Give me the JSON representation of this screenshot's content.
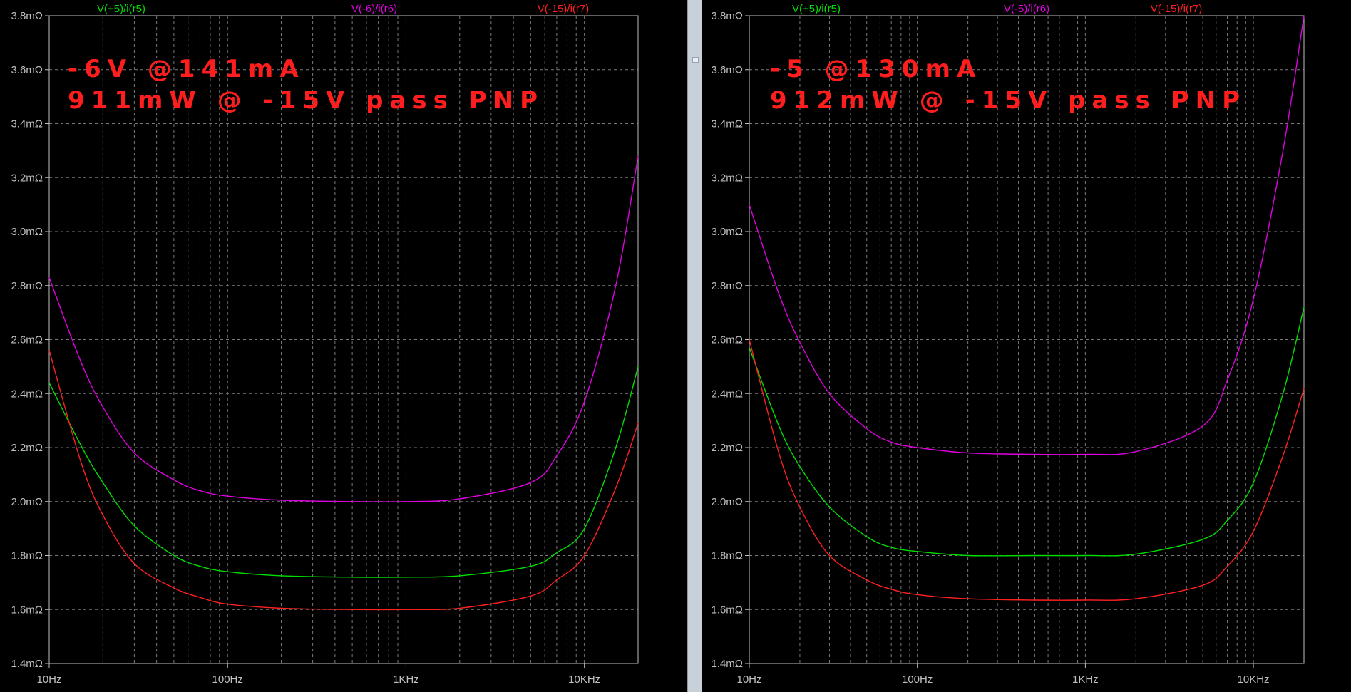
{
  "chart_data": [
    {
      "type": "line",
      "x_scale": "log",
      "xlim": [
        10,
        20000
      ],
      "ylim": [
        1.4,
        3.8
      ],
      "grid": true,
      "yticks": [
        "1.4mΩ",
        "1.6mΩ",
        "1.8mΩ",
        "2.0mΩ",
        "2.2mΩ",
        "2.4mΩ",
        "2.6mΩ",
        "2.8mΩ",
        "3.0mΩ",
        "3.2mΩ",
        "3.4mΩ",
        "3.6mΩ",
        "3.8mΩ"
      ],
      "xticks": [
        "10Hz",
        "100Hz",
        "1KHz",
        "10KHz"
      ],
      "annotations": [
        "-6V @141mA",
        "911mW  @ -15V pass PNP"
      ],
      "series": [
        {
          "name": "V(+5)/i(r5)",
          "color": "#00e000",
          "x": [
            10,
            15,
            20,
            30,
            50,
            70,
            100,
            200,
            500,
            1000,
            2000,
            5000,
            7000,
            10000,
            15000,
            20000
          ],
          "y": [
            2.44,
            2.21,
            2.07,
            1.91,
            1.8,
            1.76,
            1.74,
            1.725,
            1.72,
            1.72,
            1.725,
            1.76,
            1.81,
            1.9,
            2.2,
            2.5
          ]
        },
        {
          "name": "V(-6)/i(r6)",
          "color": "#e000e0",
          "x": [
            10,
            15,
            20,
            30,
            50,
            70,
            100,
            200,
            500,
            1000,
            2000,
            5000,
            7000,
            10000,
            15000,
            20000
          ],
          "y": [
            2.83,
            2.52,
            2.35,
            2.18,
            2.08,
            2.04,
            2.02,
            2.005,
            2.0,
            2.0,
            2.01,
            2.07,
            2.17,
            2.37,
            2.8,
            3.28
          ]
        },
        {
          "name": "V(-15)/i(r7)",
          "color": "#ff2020",
          "x": [
            10,
            15,
            20,
            30,
            50,
            70,
            100,
            200,
            500,
            1000,
            2000,
            5000,
            7000,
            10000,
            15000,
            20000
          ],
          "y": [
            2.56,
            2.15,
            1.95,
            1.77,
            1.68,
            1.645,
            1.62,
            1.605,
            1.6,
            1.6,
            1.605,
            1.65,
            1.71,
            1.8,
            2.05,
            2.29
          ]
        }
      ]
    },
    {
      "type": "line",
      "x_scale": "log",
      "xlim": [
        10,
        20000
      ],
      "ylim": [
        1.4,
        3.8
      ],
      "grid": true,
      "yticks": [
        "1.4mΩ",
        "1.6mΩ",
        "1.8mΩ",
        "2.0mΩ",
        "2.2mΩ",
        "2.4mΩ",
        "2.6mΩ",
        "2.8mΩ",
        "3.0mΩ",
        "3.2mΩ",
        "3.4mΩ",
        "3.6mΩ",
        "3.8mΩ"
      ],
      "xticks": [
        "10Hz",
        "100Hz",
        "1KHz",
        "10KHz"
      ],
      "annotations": [
        "-5 @130mA",
        "912mW @ -15V pass PNP"
      ],
      "series": [
        {
          "name": "V(+5)/i(r5)",
          "color": "#00e000",
          "x": [
            10,
            15,
            20,
            30,
            50,
            70,
            100,
            200,
            500,
            1000,
            2000,
            5000,
            7000,
            10000,
            15000,
            20000
          ],
          "y": [
            2.57,
            2.28,
            2.13,
            1.98,
            1.87,
            1.83,
            1.815,
            1.8,
            1.8,
            1.8,
            1.805,
            1.86,
            1.93,
            2.07,
            2.4,
            2.72
          ]
        },
        {
          "name": "V(-5)/i(r6)",
          "color": "#e000e0",
          "x": [
            10,
            15,
            20,
            30,
            50,
            70,
            100,
            200,
            500,
            1000,
            2000,
            5000,
            7000,
            10000,
            15000,
            20000
          ],
          "y": [
            3.1,
            2.77,
            2.59,
            2.4,
            2.27,
            2.22,
            2.2,
            2.18,
            2.175,
            2.175,
            2.185,
            2.28,
            2.45,
            2.75,
            3.3,
            3.8
          ]
        },
        {
          "name": "V(-15)/i(r7)",
          "color": "#ff2020",
          "x": [
            10,
            15,
            20,
            30,
            50,
            70,
            100,
            200,
            500,
            1000,
            2000,
            5000,
            7000,
            10000,
            15000,
            20000
          ],
          "y": [
            2.6,
            2.18,
            1.98,
            1.8,
            1.71,
            1.675,
            1.655,
            1.64,
            1.635,
            1.635,
            1.64,
            1.69,
            1.76,
            1.89,
            2.17,
            2.42
          ]
        }
      ]
    }
  ]
}
